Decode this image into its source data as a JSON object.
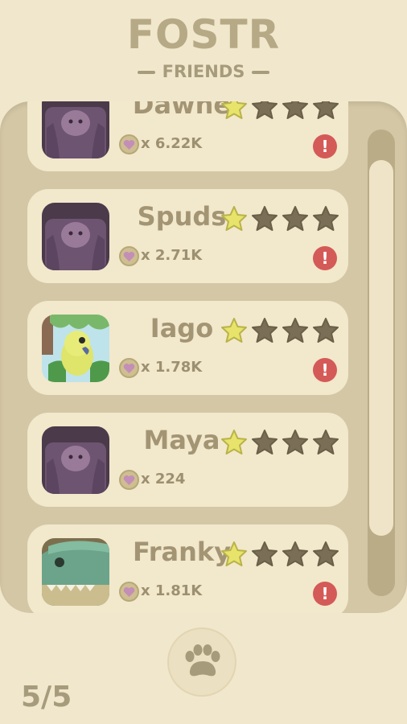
{
  "header": {
    "title": "FOSTR",
    "subtitle": "FRIENDS"
  },
  "friends": [
    {
      "name": "Dawne",
      "count": "x 6.22K",
      "stars_filled": 1,
      "stars_total": 4,
      "avatar": "tapir-avatar",
      "alert": "!"
    },
    {
      "name": "Spuds",
      "count": "x 2.71K",
      "stars_filled": 1,
      "stars_total": 4,
      "avatar": "tapir-avatar",
      "alert": "!"
    },
    {
      "name": "Iago",
      "count": "x 1.78K",
      "stars_filled": 1,
      "stars_total": 4,
      "avatar": "parrot-avatar",
      "alert": "!"
    },
    {
      "name": "Maya",
      "count": "x 224",
      "stars_filled": 1,
      "stars_total": 4,
      "avatar": "tapir-avatar",
      "alert": ""
    },
    {
      "name": "Franky",
      "count": "x 1.81K",
      "stars_filled": 1,
      "stars_total": 4,
      "avatar": "crocodile-avatar",
      "alert": "!"
    }
  ],
  "footer": {
    "page_indicator": "5/5",
    "paw_icon": "paw-icon"
  },
  "colors": {
    "background": "#f1e7cc",
    "panel": "#d4c7a5",
    "card": "#f2e8cc",
    "star_filled": "#e8e36a",
    "star_empty": "#7a6f56",
    "alert": "#d45a57",
    "heart": "#c48eb7"
  }
}
